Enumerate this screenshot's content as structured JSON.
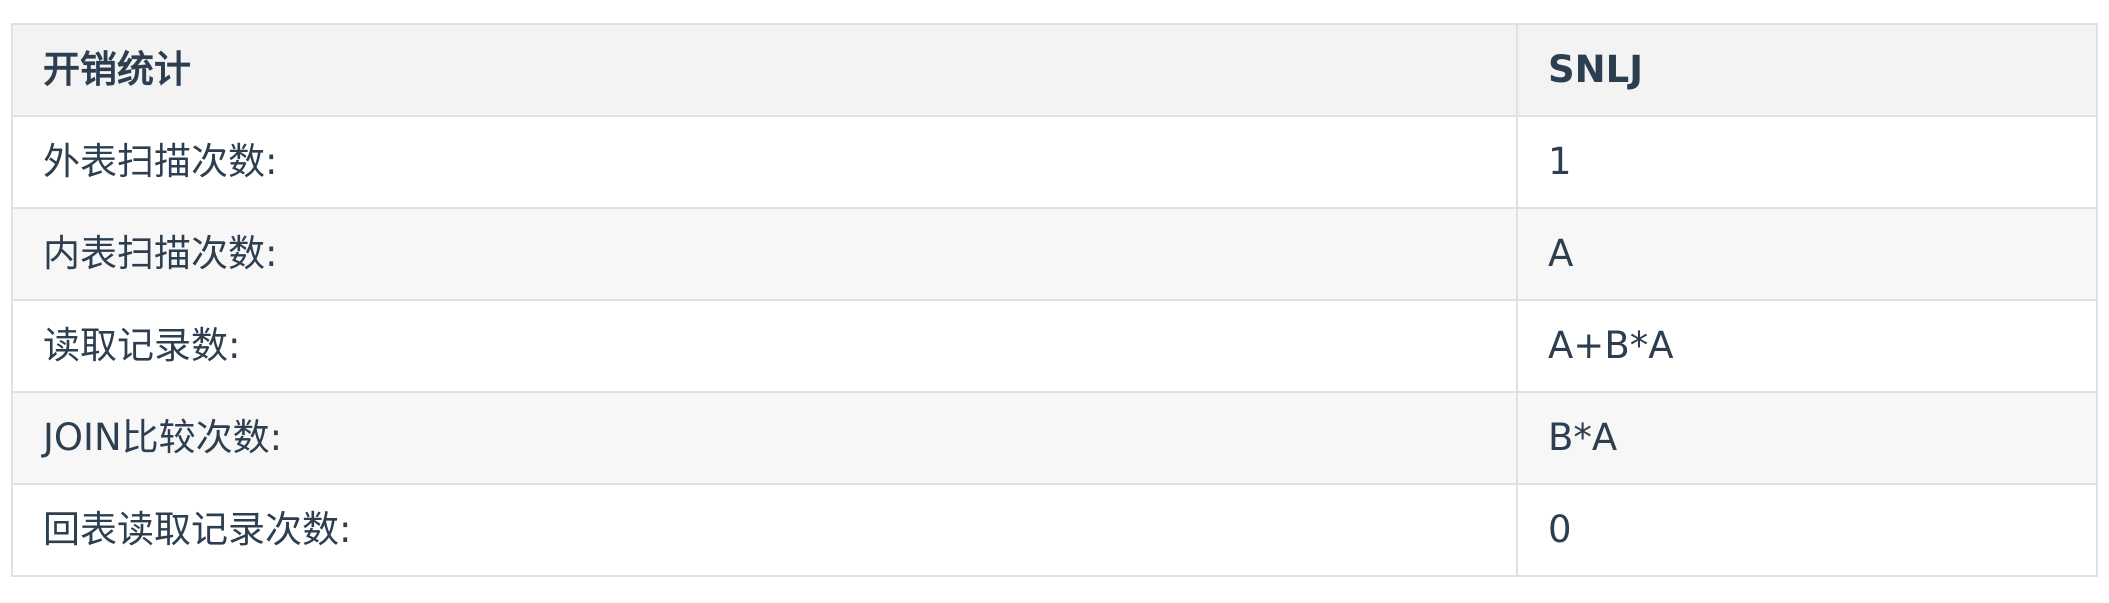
{
  "table": {
    "headers": [
      "开销统计",
      "SNLJ"
    ],
    "rows": [
      [
        "外表扫描次数:",
        "1"
      ],
      [
        "内表扫描次数:",
        "A"
      ],
      [
        "读取记录数:",
        "A+B*A"
      ],
      [
        "JOIN比较次数:",
        "B*A"
      ],
      [
        "回表读取记录次数:",
        "0"
      ]
    ]
  }
}
